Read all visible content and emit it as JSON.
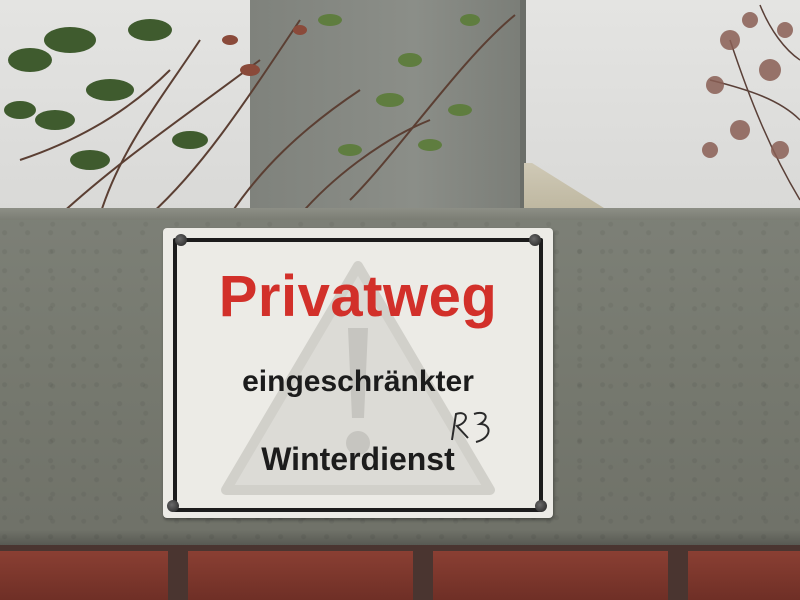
{
  "sign": {
    "title": "Privatweg",
    "line1": "eingeschränkter",
    "line2": "Winterdienst",
    "graffiti": "R3"
  },
  "colors": {
    "title_red": "#d2302a",
    "text_black": "#1c1c1c",
    "sign_background": "#ecebe6",
    "wall_concrete": "#777a70",
    "brick": "#7a352b"
  },
  "icons": {
    "warning": "faded-warning-triangle-icon"
  }
}
